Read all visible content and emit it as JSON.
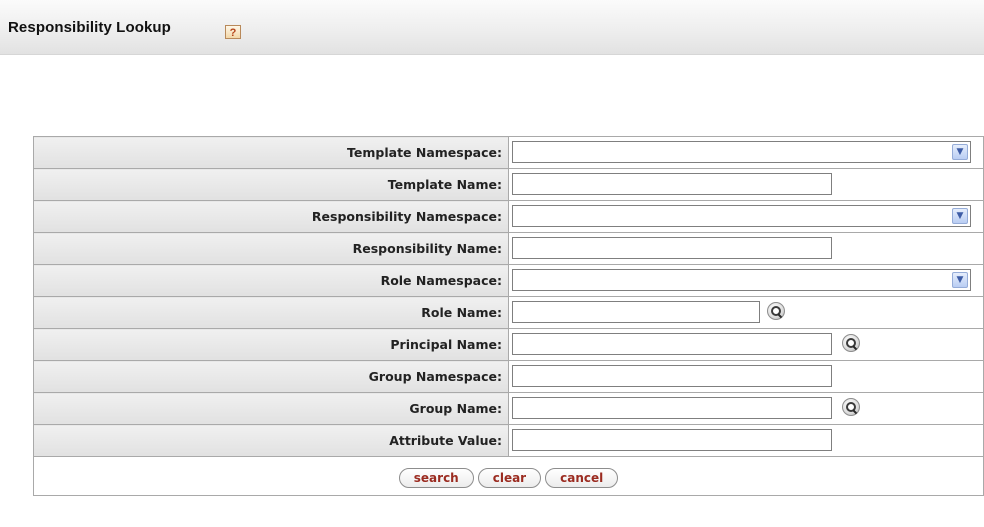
{
  "header": {
    "title": "Responsibility Lookup",
    "help_icon": "help-icon",
    "help_glyph": "?"
  },
  "form": {
    "fields": [
      {
        "label": "Template Namespace:",
        "type": "select",
        "value": ""
      },
      {
        "label": "Template Name:",
        "type": "text",
        "value": ""
      },
      {
        "label": "Responsibility Namespace:",
        "type": "select",
        "value": ""
      },
      {
        "label": "Responsibility Name:",
        "type": "text",
        "value": ""
      },
      {
        "label": "Role Namespace:",
        "type": "select",
        "value": ""
      },
      {
        "label": "Role Name:",
        "type": "text",
        "value": "",
        "lookup": true
      },
      {
        "label": "Principal Name:",
        "type": "text",
        "value": "",
        "lookup": true
      },
      {
        "label": "Group Namespace:",
        "type": "text",
        "value": ""
      },
      {
        "label": "Group Name:",
        "type": "text",
        "value": "",
        "lookup": true
      },
      {
        "label": "Attribute Value:",
        "type": "text",
        "value": ""
      }
    ]
  },
  "buttons": {
    "search": "search",
    "clear": "clear",
    "cancel": "cancel"
  },
  "colors": {
    "button_text": "#9b2b20",
    "label_bg": "#e6e6e6"
  }
}
